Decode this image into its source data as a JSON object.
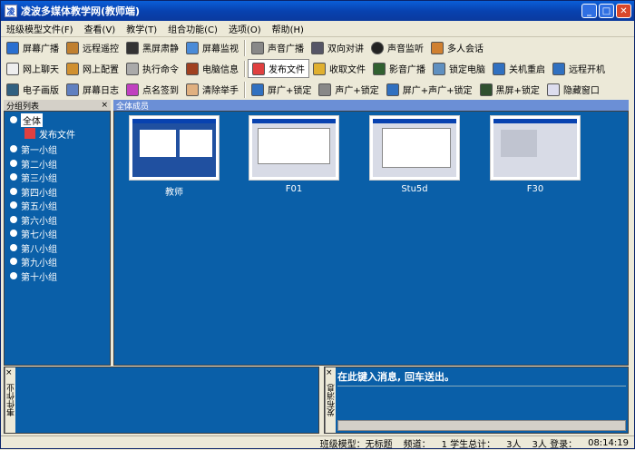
{
  "window": {
    "title": "凌波多媒体教学网(教师端)"
  },
  "menu": [
    "班级模型文件(F)",
    "查看(V)",
    "教学(T)",
    "组合功能(C)",
    "选项(O)",
    "帮助(H)"
  ],
  "toolbar": {
    "row1": [
      "屏幕广播",
      "远程遥控",
      "黑屏肃静",
      "屏幕监视",
      "声音广播",
      "双向对讲",
      "声音监听",
      "多人会话"
    ],
    "row2": [
      "网上聊天",
      "网上配置",
      "执行命令",
      "电脑信息",
      "发布文件",
      "收取文件",
      "影音广播",
      "锁定电脑",
      "关机重启",
      "远程开机"
    ],
    "row3": [
      "电子画版",
      "屏幕日志",
      "点名签到",
      "清除举手",
      "屏广+锁定",
      "声广+锁定",
      "屏广+声广+锁定",
      "黑屏+锁定",
      "隐藏窗口"
    ]
  },
  "left_panel": {
    "header": "分组列表",
    "close": "×",
    "all": "全体",
    "publish": "发布文件",
    "groups": [
      "第一小组",
      "第二小组",
      "第三小组",
      "第四小组",
      "第五小组",
      "第六小组",
      "第七小组",
      "第八小组",
      "第九小组",
      "第十小组"
    ]
  },
  "main_panel": {
    "header": "全体成员",
    "members": [
      {
        "name": "教师"
      },
      {
        "name": "F01"
      },
      {
        "name": "Stu5d"
      },
      {
        "name": "F30"
      }
    ]
  },
  "bottom_left": {
    "label": "事件作业",
    "close": "×"
  },
  "bottom_right": {
    "label": "发布消息",
    "close": "×",
    "prompt": "在此键入消息, 回车送出。"
  },
  "status": {
    "model": "班级模型：无标题",
    "channel": "频道：",
    "students": "1 学生总计：",
    "count": "3人",
    "login": "3人 登录：",
    "time": "08:14:19"
  }
}
